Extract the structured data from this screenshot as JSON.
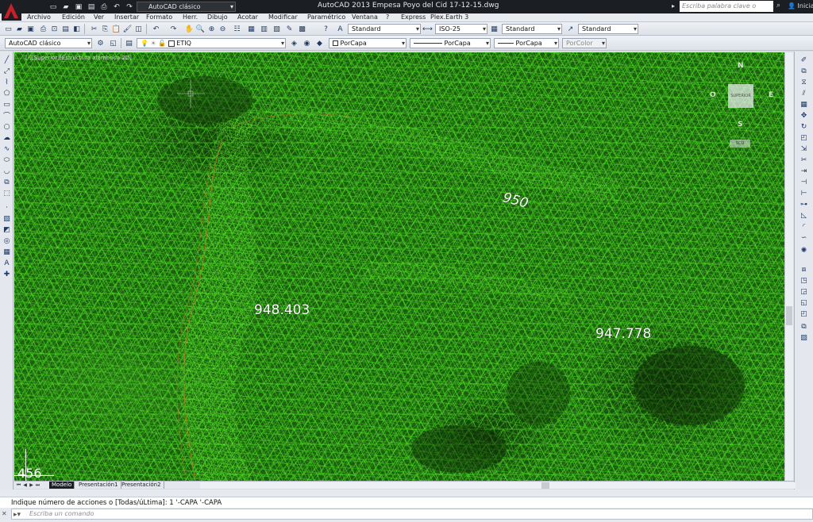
{
  "titlebar": {
    "app_title": "AutoCAD 2013   Empesa Poyo del Cid 17-12-15.dwg",
    "workspace": "AutoCAD clásico",
    "search_placeholder": "Escriba palabra clave o frase",
    "signin": "Iniciar"
  },
  "menu": [
    "Archivo",
    "Edición",
    "Ver",
    "Insertar",
    "Formato",
    "Herr.",
    "Dibujo",
    "Acotar",
    "Modificar",
    "Paramétrico",
    "Ventana",
    "?",
    "Express",
    "Plex.Earth 3"
  ],
  "toolbar1": {
    "text_style": "Standard",
    "dim_style": "ISO-25",
    "table_style": "Standard",
    "mleader_style": "Standard"
  },
  "toolbar2": {
    "workspace": "AutoCAD clásico",
    "layer": "ETIQ",
    "color": "PorCapa",
    "linetype": "PorCapa",
    "lineweight": "PorCapa",
    "plotstyle": "PorColor"
  },
  "viewport": {
    "label": "[-][Superior][Estructura alámbrica 2D]",
    "elevation_labels": [
      "950",
      "948.403",
      "947.778"
    ],
    "coord_readout": "456"
  },
  "viewcube": {
    "north": "N",
    "south": "S",
    "east": "E",
    "west": "O",
    "face": "SUPERIOR",
    "wcs": "SCU"
  },
  "tabs": [
    "Modelo",
    "Presentación1",
    "Presentación2"
  ],
  "command": {
    "history": "Indique número de acciones o [Todas/úLtima]: 1 '-CAPA '-CAPA",
    "placeholder": "Escriba un comando"
  },
  "colors": {
    "mesh": "#3fd41a",
    "background": "#1b5c0f",
    "breakline": "#c07a2a"
  }
}
